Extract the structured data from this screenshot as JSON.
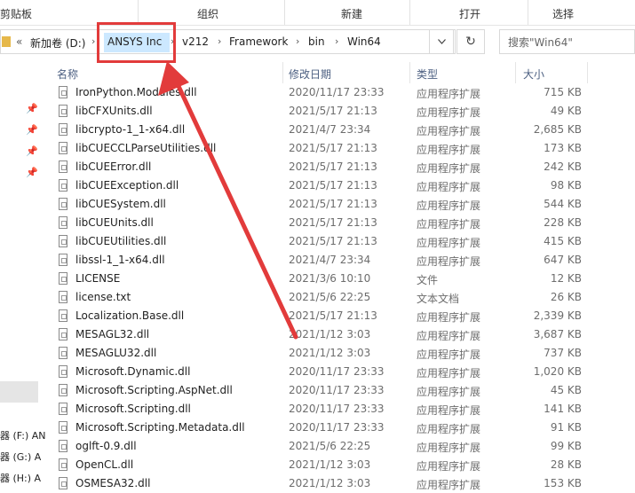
{
  "ribbon": {
    "groups": [
      "剪贴板",
      "组织",
      "新建",
      "打开",
      "选择"
    ]
  },
  "address": {
    "back": "«",
    "segments": [
      "新加卷 (D:)",
      "ANSYS Inc",
      "v212",
      "Framework",
      "bin",
      "Win64"
    ],
    "separator": "›",
    "dropdown_icon": "chevron-down-icon",
    "refresh_icon": "refresh-icon",
    "refresh_glyph": "↻"
  },
  "search": {
    "placeholder": "搜索\"Win64\""
  },
  "columns": {
    "name": "名称",
    "date": "修改日期",
    "type": "类型",
    "size": "大小"
  },
  "nav": {
    "pin_glyph": "📌",
    "drives": [
      "器 (F:) AN",
      "器 (G:) A",
      "器 (H:) A"
    ]
  },
  "files": [
    {
      "name": "IronPython.Modules.dll",
      "date": "2020/11/17 23:33",
      "type": "应用程序扩展",
      "size": "715 KB"
    },
    {
      "name": "libCFXUnits.dll",
      "date": "2021/5/17 21:13",
      "type": "应用程序扩展",
      "size": "49 KB"
    },
    {
      "name": "libcrypto-1_1-x64.dll",
      "date": "2021/4/7 23:34",
      "type": "应用程序扩展",
      "size": "2,685 KB"
    },
    {
      "name": "libCUECCLParseUtilities.dll",
      "date": "2021/5/17 21:13",
      "type": "应用程序扩展",
      "size": "173 KB"
    },
    {
      "name": "libCUEError.dll",
      "date": "2021/5/17 21:13",
      "type": "应用程序扩展",
      "size": "242 KB"
    },
    {
      "name": "libCUEException.dll",
      "date": "2021/5/17 21:13",
      "type": "应用程序扩展",
      "size": "98 KB"
    },
    {
      "name": "libCUESystem.dll",
      "date": "2021/5/17 21:13",
      "type": "应用程序扩展",
      "size": "544 KB"
    },
    {
      "name": "libCUEUnits.dll",
      "date": "2021/5/17 21:13",
      "type": "应用程序扩展",
      "size": "228 KB"
    },
    {
      "name": "libCUEUtilities.dll",
      "date": "2021/5/17 21:13",
      "type": "应用程序扩展",
      "size": "415 KB"
    },
    {
      "name": "libssl-1_1-x64.dll",
      "date": "2021/4/7 23:34",
      "type": "应用程序扩展",
      "size": "647 KB"
    },
    {
      "name": "LICENSE",
      "date": "2021/3/6 10:10",
      "type": "文件",
      "size": "12 KB"
    },
    {
      "name": "license.txt",
      "date": "2021/5/6 22:25",
      "type": "文本文档",
      "size": "26 KB"
    },
    {
      "name": "Localization.Base.dll",
      "date": "2021/5/17 21:13",
      "type": "应用程序扩展",
      "size": "2,339 KB"
    },
    {
      "name": "MESAGL32.dll",
      "date": "2021/1/12 3:03",
      "type": "应用程序扩展",
      "size": "3,687 KB"
    },
    {
      "name": "MESAGLU32.dll",
      "date": "2021/1/12 3:03",
      "type": "应用程序扩展",
      "size": "737 KB"
    },
    {
      "name": "Microsoft.Dynamic.dll",
      "date": "2020/11/17 23:33",
      "type": "应用程序扩展",
      "size": "1,020 KB"
    },
    {
      "name": "Microsoft.Scripting.AspNet.dll",
      "date": "2020/11/17 23:33",
      "type": "应用程序扩展",
      "size": "45 KB"
    },
    {
      "name": "Microsoft.Scripting.dll",
      "date": "2020/11/17 23:33",
      "type": "应用程序扩展",
      "size": "141 KB"
    },
    {
      "name": "Microsoft.Scripting.Metadata.dll",
      "date": "2020/11/17 23:33",
      "type": "应用程序扩展",
      "size": "91 KB"
    },
    {
      "name": "oglft-0.9.dll",
      "date": "2021/5/6 22:25",
      "type": "应用程序扩展",
      "size": "99 KB"
    },
    {
      "name": "OpenCL.dll",
      "date": "2021/1/12 3:03",
      "type": "应用程序扩展",
      "size": "28 KB"
    },
    {
      "name": "OSMESA32.dll",
      "date": "2021/1/12 3:03",
      "type": "应用程序扩展",
      "size": "153 KB"
    }
  ],
  "annotation": {
    "color": "#e23b3b"
  }
}
